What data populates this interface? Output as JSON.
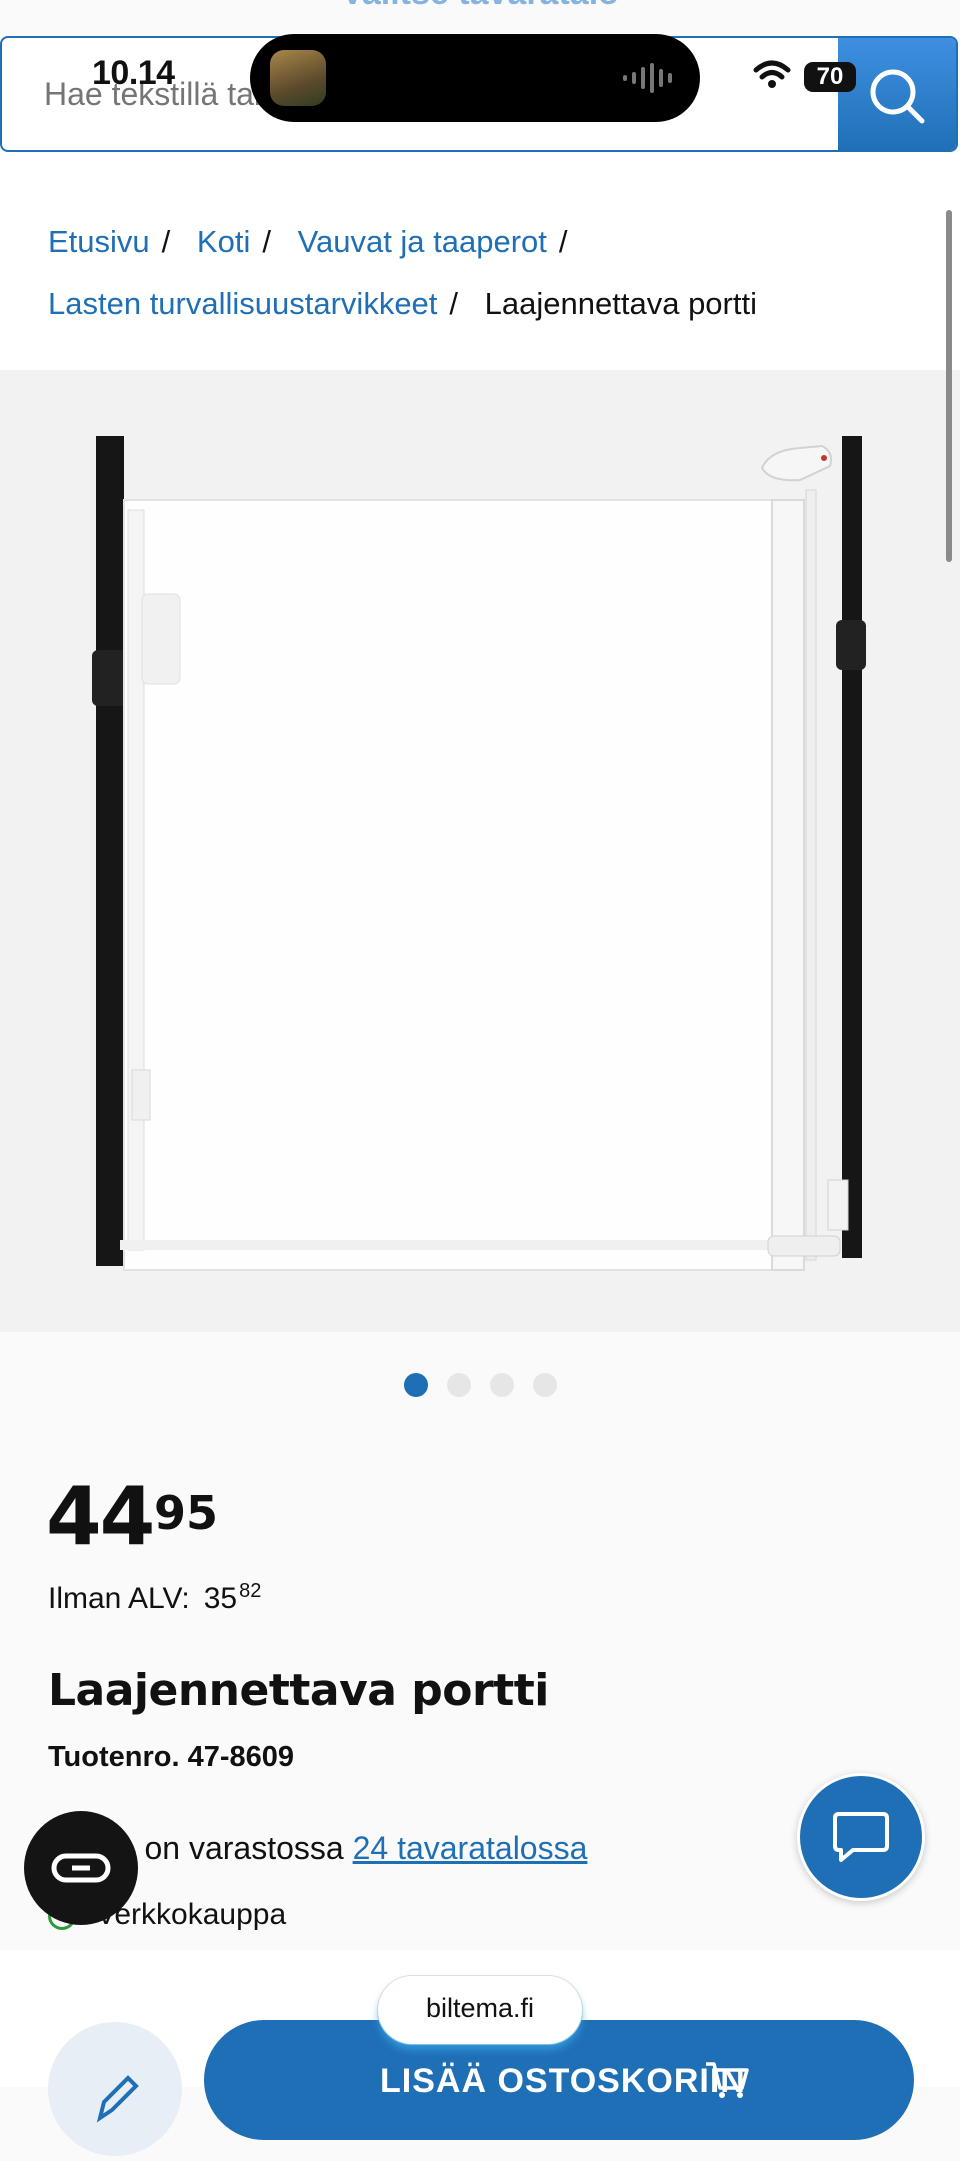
{
  "top_partial_text": "Valitse tavaratalo",
  "status_bar": {
    "time": "10.14",
    "battery": "70"
  },
  "search": {
    "placeholder": "Hae tekstillä tai"
  },
  "breadcrumb": {
    "home": "Etusivu",
    "home_category": "Koti",
    "category": "Vauvat ja taaperot",
    "subcategory": "Lasten turvallisuustarvikkeet",
    "current": "Laajennettava portti",
    "separator": "/"
  },
  "carousel": {
    "slide_count": 4,
    "active_index": 0
  },
  "product": {
    "price_int": "44",
    "price_dec": "95",
    "vat_label": "Ilman ALV:",
    "vat_int": "35",
    "vat_dec": "82",
    "title": "Laajennettava portti",
    "number": "Tuotenro. 47-8609"
  },
  "availability": {
    "stock_text": "tta on varastossa",
    "stock_link": "24 tavaratalossa",
    "online": "Verkkokauppa"
  },
  "footer": {
    "domain": "biltema.fi",
    "add_to_cart": "LISÄÄ OSTOSKORIIN"
  },
  "colors": {
    "accent": "#1f6fb6",
    "success": "#2e9b3a",
    "dark": "#141414"
  },
  "icons": [
    "search-icon",
    "wifi-icon",
    "chat-icon",
    "infinity-icon",
    "edit-icon",
    "cart-icon",
    "check-circle-icon"
  ]
}
